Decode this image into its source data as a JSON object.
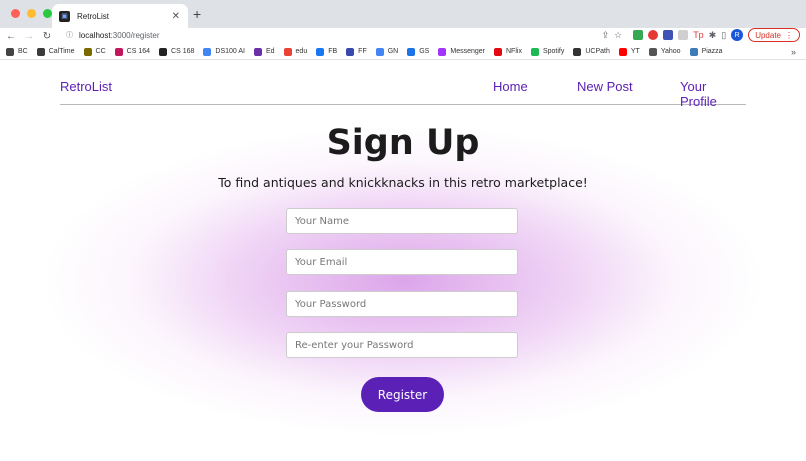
{
  "browser": {
    "tab_title": "RetroList",
    "url_host": "localhost",
    "url_path": ":3000/register",
    "update_label": "Update",
    "profile_initial": "R",
    "bookmarks": [
      {
        "label": "BC",
        "color": "#444444"
      },
      {
        "label": "CalTime",
        "color": "#3b3b3b"
      },
      {
        "label": "CC",
        "color": "#7a6a00"
      },
      {
        "label": "CS 164",
        "color": "#c2185b"
      },
      {
        "label": "CS 168",
        "color": "#222222"
      },
      {
        "label": "DS100 AI",
        "color": "#4285f4"
      },
      {
        "label": "Ed",
        "color": "#6b2fa7"
      },
      {
        "label": "edu",
        "color": "#ea4335"
      },
      {
        "label": "FB",
        "color": "#1877f2"
      },
      {
        "label": "FF",
        "color": "#3949ab"
      },
      {
        "label": "GN",
        "color": "#4285f4"
      },
      {
        "label": "GS",
        "color": "#1a73e8"
      },
      {
        "label": "Messenger",
        "color": "#a334fa"
      },
      {
        "label": "NFlix",
        "color": "#e50914"
      },
      {
        "label": "Spotify",
        "color": "#1db954"
      },
      {
        "label": "UCPath",
        "color": "#333333"
      },
      {
        "label": "YT",
        "color": "#ff0000"
      },
      {
        "label": "Yahoo",
        "color": "#555555"
      },
      {
        "label": "Piazza",
        "color": "#3e7bb7"
      }
    ]
  },
  "site": {
    "brand": "RetroList",
    "nav": [
      "Home",
      "New Post",
      "Your Profile"
    ],
    "accent": "#5b21b6"
  },
  "form": {
    "heading": "Sign Up",
    "subtitle": "To find antiques and knickknacks in this retro marketplace!",
    "name_placeholder": "Your Name",
    "email_placeholder": "Your Email",
    "password_placeholder": "Your Password",
    "confirm_placeholder": "Re-enter your Password",
    "submit_label": "Register"
  }
}
